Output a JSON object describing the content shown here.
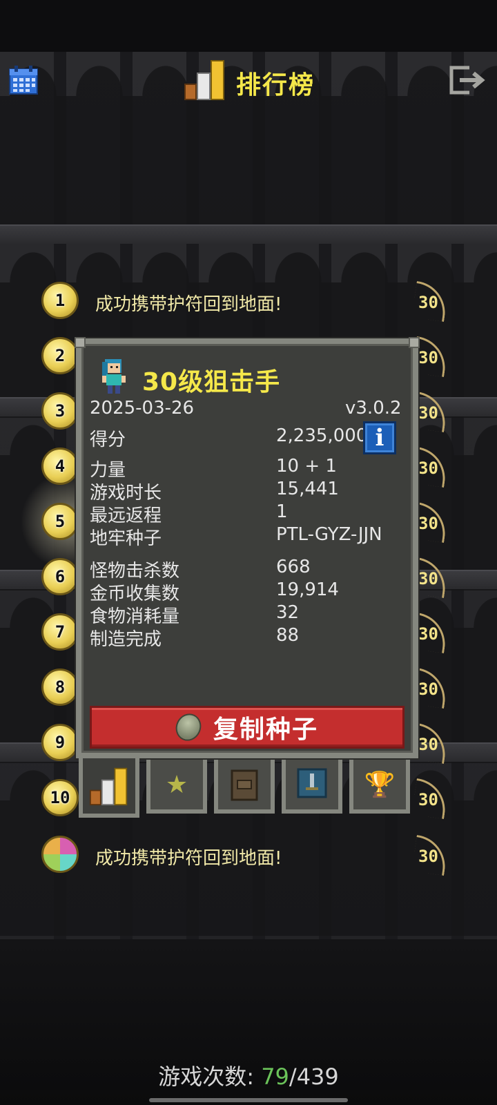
{
  "header": {
    "title": "排行榜",
    "calendar_icon": "calendar-icon",
    "exit_icon": "exit-icon",
    "rank_icon": "ranking-bars-icon"
  },
  "colors": {
    "title_yellow": "#f5e84a",
    "copy_button_red": "#c42e2e",
    "info_button_blue": "#1c5fb8",
    "games_current_green": "#6bc35a"
  },
  "leaderboard": {
    "rows": [
      {
        "rank": "1",
        "text": "成功携带护符回到地面!",
        "level": "30"
      },
      {
        "rank": "2",
        "text": "",
        "level": "30"
      },
      {
        "rank": "3",
        "text": "",
        "level": "30"
      },
      {
        "rank": "4",
        "text": "",
        "level": "30"
      },
      {
        "rank": "5",
        "text": "",
        "level": "30"
      },
      {
        "rank": "6",
        "text": "",
        "level": "30"
      },
      {
        "rank": "7",
        "text": "",
        "level": "30"
      },
      {
        "rank": "8",
        "text": "",
        "level": "30"
      },
      {
        "rank": "9",
        "text": "",
        "level": "30"
      },
      {
        "rank": "10",
        "text": "",
        "level": "30"
      },
      {
        "rank": "",
        "text": "成功携带护符回到地面!",
        "level": "30"
      }
    ]
  },
  "dialog": {
    "hero_title": "30级狙击手",
    "date": "2025-03-26",
    "version": "v3.0.2",
    "score_label": "得分",
    "score_value": "2,235,000",
    "stats": [
      {
        "label": "力量",
        "value": "10 + 1"
      },
      {
        "label": "游戏时长",
        "value": "15,441"
      },
      {
        "label": "最远返程",
        "value": "1"
      },
      {
        "label": "地牢种子",
        "value": "PTL-GYZ-JJN"
      },
      {
        "label": "怪物击杀数",
        "value": "668"
      },
      {
        "label": "金币收集数",
        "value": "19,914"
      },
      {
        "label": "食物消耗量",
        "value": "32"
      },
      {
        "label": "制造完成",
        "value": "88"
      }
    ],
    "copy_seed_label": "复制种子",
    "info_icon": "info-icon"
  },
  "tabs": [
    {
      "icon": "stats-bars-icon"
    },
    {
      "icon": "star-badge-icon"
    },
    {
      "icon": "backpack-icon"
    },
    {
      "icon": "sword-badge-icon"
    },
    {
      "icon": "trophy-icon"
    }
  ],
  "footer": {
    "games_label": "游戏次数:",
    "games_current": "79",
    "games_total": "/439"
  }
}
